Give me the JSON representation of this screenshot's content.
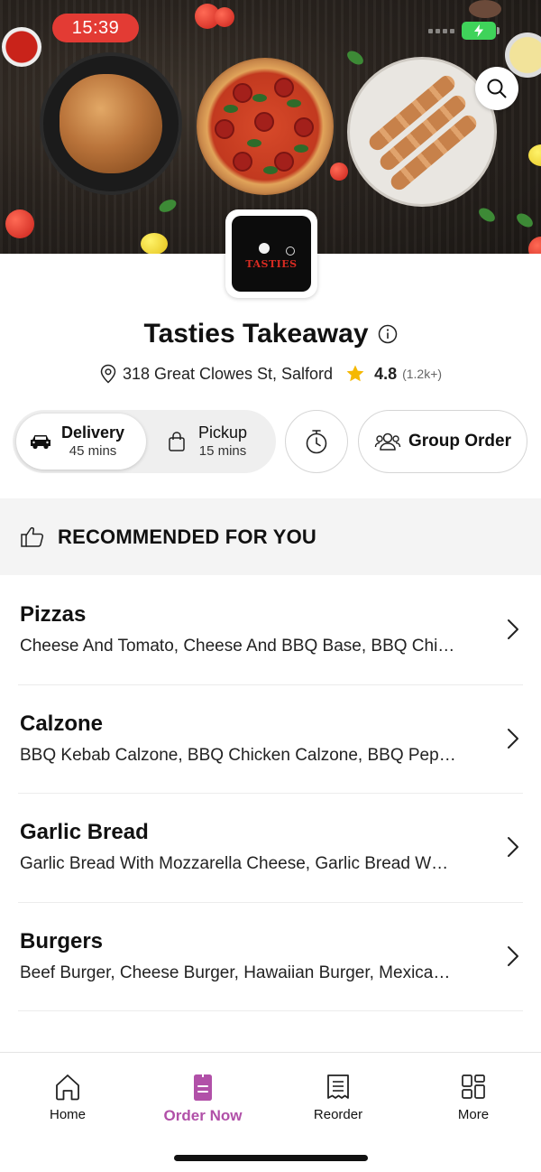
{
  "status_bar": {
    "time": "15:39"
  },
  "header": {
    "search_icon": "search-icon"
  },
  "restaurant": {
    "logo_text": "TASTIES",
    "name": "Tasties Takeaway",
    "address": "318 Great Clowes St, Salford",
    "rating": "4.8",
    "rating_count": "(1.2k+)"
  },
  "order_modes": {
    "delivery": {
      "label": "Delivery",
      "time": "45 mins",
      "selected": true
    },
    "pickup": {
      "label": "Pickup",
      "time": "15 mins",
      "selected": false
    },
    "group_order_label": "Group Order"
  },
  "recommended": {
    "label": "RECOMMENDED FOR YOU"
  },
  "categories": [
    {
      "name": "Pizzas",
      "items": "Cheese And Tomato, Cheese And BBQ Base, BBQ Chi…"
    },
    {
      "name": "Calzone",
      "items": "BBQ Kebab Calzone, BBQ Chicken Calzone, BBQ Pep…"
    },
    {
      "name": "Garlic Bread",
      "items": "Garlic Bread With Mozzarella Cheese, Garlic Bread W…"
    },
    {
      "name": "Burgers",
      "items": "Beef Burger, Cheese Burger, Hawaiian Burger, Mexica…"
    }
  ],
  "bottom_nav": [
    {
      "label": "Home",
      "icon": "home-icon",
      "active": false
    },
    {
      "label": "Order Now",
      "icon": "order-icon",
      "active": true
    },
    {
      "label": "Reorder",
      "icon": "receipt-icon",
      "active": false
    },
    {
      "label": "More",
      "icon": "grid-icon",
      "active": false
    }
  ],
  "colors": {
    "accent": "#b150a8",
    "status_time_bg": "#e33b34",
    "battery": "#3fd35a",
    "star": "#f5b800"
  }
}
